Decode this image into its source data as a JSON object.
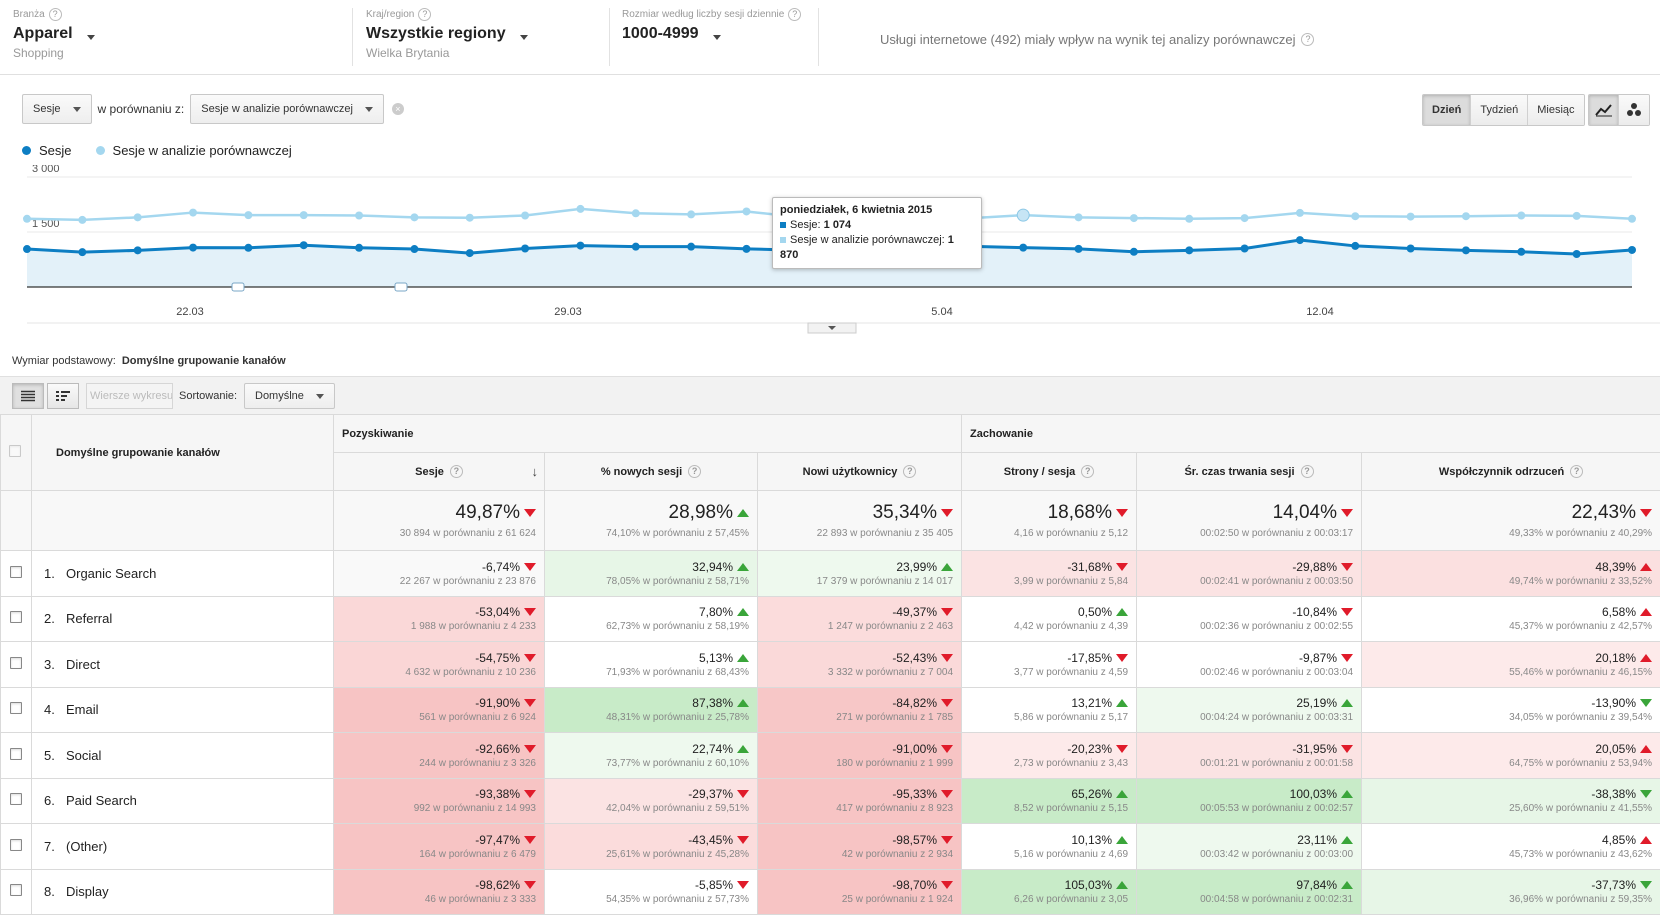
{
  "filters": [
    {
      "label": "Branża",
      "value": "Apparel",
      "sub": "Shopping"
    },
    {
      "label": "Kraj/region",
      "value": "Wszystkie regiony",
      "sub": "Wielka Brytania"
    },
    {
      "label": "Rozmiar według liczby sesji dziennie",
      "value": "1000-4999",
      "sub": ""
    }
  ],
  "notice": "Usługi internetowe (492) miały wpływ na wynik tej analizy porównawczej",
  "controls": {
    "metric": "Sesje",
    "compare_label": "w porównaniu z:",
    "compare_value": "Sesje w analizie porównawczej",
    "periods": [
      "Dzień",
      "Tydzień",
      "Miesiąc"
    ],
    "active_period": "Dzień"
  },
  "legend": [
    {
      "name": "Sesje",
      "color": "#0d7ec3"
    },
    {
      "name": "Sesje w analizie porównawczej",
      "color": "#a4d7ef"
    }
  ],
  "chart_data": {
    "type": "line",
    "y_ticks": [
      "3 000",
      "1 500"
    ],
    "x_ticks": [
      "22.03",
      "29.03",
      "5.04",
      "12.04"
    ],
    "ylim": [
      0,
      3000
    ],
    "series": [
      {
        "name": "Sesje",
        "color": "#0d7ec3",
        "values": [
          1035,
          950,
          1000,
          1075,
          1070,
          1140,
          1070,
          1035,
          925,
          1050,
          1130,
          1100,
          1100,
          1040,
          1000,
          1180,
          1074,
          1110,
          1074,
          1040,
          960,
          1000,
          1050,
          1280,
          1120,
          1050,
          1000,
          960,
          900,
          1010
        ]
      },
      {
        "name": "Sesje w analizie porównawczej",
        "color": "#a4d7ef",
        "values": [
          1860,
          1830,
          1900,
          2030,
          1960,
          1960,
          1950,
          1900,
          1890,
          1950,
          2130,
          2010,
          1980,
          2060,
          1900,
          1930,
          1870,
          1870,
          1960,
          1900,
          1880,
          1860,
          1880,
          2020,
          1930,
          1920,
          1930,
          1950,
          1940,
          1860
        ]
      }
    ],
    "tooltip": {
      "title": "poniedziałek, 6 kwietnia 2015",
      "s1_label": "Sesje:",
      "s1_value": "1 074",
      "s2_label": "Sesje w analizie porównawczej:",
      "s2_value": "1 870"
    }
  },
  "dimension": {
    "label": "Wymiar podstawowy:",
    "value": "Domyślne grupowanie kanałów"
  },
  "toolbar": {
    "plot_rows": "Wiersze wykresu",
    "sort_label": "Sortowanie:",
    "sort_value": "Domyślne"
  },
  "table": {
    "dim_header": "Domyślne grupowanie kanałów",
    "groups": [
      "Pozyskiwanie",
      "Zachowanie"
    ],
    "columns": [
      "Sesje",
      "% nowych sesji",
      "Nowi użytkownicy",
      "Strony / sesja",
      "Śr. czas trwania sesji",
      "Współczynnik odrzuceń"
    ],
    "summary": [
      {
        "v": "49,87%",
        "d": "dn",
        "c": "30 894 w porównaniu z 61 624"
      },
      {
        "v": "28,98%",
        "d": "up",
        "c": "74,10% w porównaniu z 57,45%"
      },
      {
        "v": "35,34%",
        "d": "dn",
        "c": "22 893 w porównaniu z 35 405"
      },
      {
        "v": "18,68%",
        "d": "dn",
        "c": "4,16 w porównaniu z 5,12"
      },
      {
        "v": "14,04%",
        "d": "dn",
        "c": "00:02:50 w porównaniu z 00:03:17"
      },
      {
        "v": "22,43%",
        "d": "dn",
        "c": "49,33% w porównaniu z 40,29%"
      }
    ],
    "rows": [
      {
        "n": "1.",
        "name": "Organic Search",
        "cells": [
          {
            "v": "-6,74%",
            "d": "dn",
            "c": "22 267 w porównaniu z 23 876",
            "bg": "#f9f9f9"
          },
          {
            "v": "32,94%",
            "d": "up",
            "c": "78,05% w porównaniu z 58,71%",
            "bg": "#e7f6e7"
          },
          {
            "v": "23,99%",
            "d": "up",
            "c": "17 379 w porównaniu z 14 017",
            "bg": "#eef9ee"
          },
          {
            "v": "-31,68%",
            "d": "dn",
            "c": "3,99 w porównaniu z 5,84",
            "bg": "#fbe3e3"
          },
          {
            "v": "-29,88%",
            "d": "dn",
            "c": "00:02:41 w porównaniu z 00:03:50",
            "bg": "#fbe3e3"
          },
          {
            "v": "48,39%",
            "d": "up-red",
            "c": "49,74% w porównaniu z 33,52%",
            "bg": "#fbe0e0"
          }
        ]
      },
      {
        "n": "2.",
        "name": "Referral",
        "cells": [
          {
            "v": "-53,04%",
            "d": "dn",
            "c": "1 988 w porównaniu z 4 233",
            "bg": "#fad8d8"
          },
          {
            "v": "7,80%",
            "d": "up",
            "c": "62,73% w porównaniu z 58,19%",
            "bg": "#ffffff"
          },
          {
            "v": "-49,37%",
            "d": "dn",
            "c": "1 247 w porównaniu z 2 463",
            "bg": "#fbdcdc"
          },
          {
            "v": "0,50%",
            "d": "up",
            "c": "4,42 w porównaniu z 4,39",
            "bg": "#ffffff"
          },
          {
            "v": "-10,84%",
            "d": "dn",
            "c": "00:02:36 w porównaniu z 00:02:55",
            "bg": "#ffffff"
          },
          {
            "v": "6,58%",
            "d": "up-red",
            "c": "45,37% w porównaniu z 42,57%",
            "bg": "#ffffff"
          }
        ]
      },
      {
        "n": "3.",
        "name": "Direct",
        "cells": [
          {
            "v": "-54,75%",
            "d": "dn",
            "c": "4 632 w porównaniu z 10 236",
            "bg": "#fad6d6"
          },
          {
            "v": "5,13%",
            "d": "up",
            "c": "71,93% w porównaniu z 68,43%",
            "bg": "#ffffff"
          },
          {
            "v": "-52,43%",
            "d": "dn",
            "c": "3 332 w porównaniu z 7 004",
            "bg": "#fad9d9"
          },
          {
            "v": "-17,85%",
            "d": "dn",
            "c": "3,77 w porównaniu z 4,59",
            "bg": "#ffffff"
          },
          {
            "v": "-9,87%",
            "d": "dn",
            "c": "00:02:46 w porównaniu z 00:03:04",
            "bg": "#ffffff"
          },
          {
            "v": "20,18%",
            "d": "up-red",
            "c": "55,46% w porównaniu z 46,15%",
            "bg": "#fdeaea"
          }
        ]
      },
      {
        "n": "4.",
        "name": "Email",
        "cells": [
          {
            "v": "-91,90%",
            "d": "dn",
            "c": "561 w porównaniu z 6 924",
            "bg": "#f7c4c4"
          },
          {
            "v": "87,38%",
            "d": "up",
            "c": "48,31% w porównaniu z 25,78%",
            "bg": "#c8ebc8"
          },
          {
            "v": "-84,82%",
            "d": "dn",
            "c": "271 w porównaniu z 1 785",
            "bg": "#f7c7c7"
          },
          {
            "v": "13,21%",
            "d": "up",
            "c": "5,86 w porównaniu z 5,17",
            "bg": "#ffffff"
          },
          {
            "v": "25,19%",
            "d": "up",
            "c": "00:04:24 w porównaniu z 00:03:31",
            "bg": "#eef9ee"
          },
          {
            "v": "-13,90%",
            "d": "dn-green",
            "c": "34,05% w porównaniu z 39,54%",
            "bg": "#ffffff"
          }
        ]
      },
      {
        "n": "5.",
        "name": "Social",
        "cells": [
          {
            "v": "-92,66%",
            "d": "dn",
            "c": "244 w porównaniu z 3 326",
            "bg": "#f7c4c4"
          },
          {
            "v": "22,74%",
            "d": "up",
            "c": "73,77% w porównaniu z 60,10%",
            "bg": "#eef9ee"
          },
          {
            "v": "-91,00%",
            "d": "dn",
            "c": "180 w porównaniu z 1 999",
            "bg": "#f7c4c4"
          },
          {
            "v": "-20,23%",
            "d": "dn",
            "c": "2,73 w porównaniu z 3,43",
            "bg": "#fdeaea"
          },
          {
            "v": "-31,95%",
            "d": "dn",
            "c": "00:01:21 w porównaniu z 00:01:58",
            "bg": "#fbe3e3"
          },
          {
            "v": "20,05%",
            "d": "up-red",
            "c": "64,75% w porównaniu z 53,94%",
            "bg": "#fdeaea"
          }
        ]
      },
      {
        "n": "6.",
        "name": "Paid Search",
        "cells": [
          {
            "v": "-93,38%",
            "d": "dn",
            "c": "992 w porównaniu z 14 993",
            "bg": "#f7c4c4"
          },
          {
            "v": "-29,37%",
            "d": "dn",
            "c": "42,04% w porównaniu z 59,51%",
            "bg": "#fbe3e3"
          },
          {
            "v": "-95,33%",
            "d": "dn",
            "c": "417 w porównaniu z 8 923",
            "bg": "#f7c4c4"
          },
          {
            "v": "65,26%",
            "d": "up",
            "c": "8,52 w porównaniu z 5,15",
            "bg": "#c8ebc8"
          },
          {
            "v": "100,03%",
            "d": "up",
            "c": "00:05:53 w porównaniu z 00:02:57",
            "bg": "#c8ebc8"
          },
          {
            "v": "-38,38%",
            "d": "dn-green",
            "c": "25,60% w porównaniu z 41,55%",
            "bg": "#e7f6e7"
          }
        ]
      },
      {
        "n": "7.",
        "name": "(Other)",
        "cells": [
          {
            "v": "-97,47%",
            "d": "dn",
            "c": "164 w porównaniu z 6 479",
            "bg": "#f7c4c4"
          },
          {
            "v": "-43,45%",
            "d": "dn",
            "c": "25,61% w porównaniu z 45,28%",
            "bg": "#fbdcdc"
          },
          {
            "v": "-98,57%",
            "d": "dn",
            "c": "42 w porównaniu z 2 934",
            "bg": "#f7c4c4"
          },
          {
            "v": "10,13%",
            "d": "up",
            "c": "5,16 w porównaniu z 4,69",
            "bg": "#ffffff"
          },
          {
            "v": "23,11%",
            "d": "up",
            "c": "00:03:42 w porównaniu z 00:03:00",
            "bg": "#eef9ee"
          },
          {
            "v": "4,85%",
            "d": "up-red",
            "c": "45,73% w porównaniu z 43,62%",
            "bg": "#ffffff"
          }
        ]
      },
      {
        "n": "8.",
        "name": "Display",
        "cells": [
          {
            "v": "-98,62%",
            "d": "dn",
            "c": "46 w porównaniu z 3 333",
            "bg": "#f7c4c4"
          },
          {
            "v": "-5,85%",
            "d": "dn",
            "c": "54,35% w porównaniu z 57,73%",
            "bg": "#ffffff"
          },
          {
            "v": "-98,70%",
            "d": "dn",
            "c": "25 w porównaniu z 1 924",
            "bg": "#f7c4c4"
          },
          {
            "v": "105,03%",
            "d": "up",
            "c": "6,26 w porównaniu z 3,05",
            "bg": "#c8ebc8"
          },
          {
            "v": "97,84%",
            "d": "up",
            "c": "00:04:58 w porównaniu z 00:02:31",
            "bg": "#c8ebc8"
          },
          {
            "v": "-37,73%",
            "d": "dn-green",
            "c": "36,96% w porównaniu z 59,35%",
            "bg": "#e7f6e7"
          }
        ]
      }
    ]
  }
}
